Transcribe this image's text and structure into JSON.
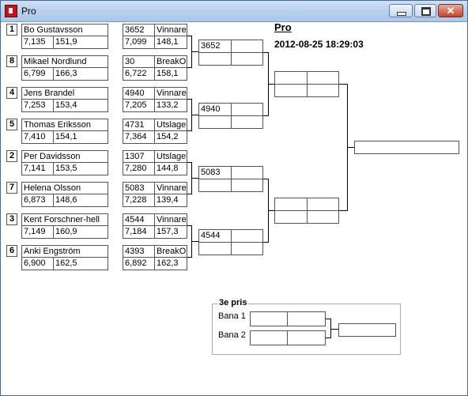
{
  "window": {
    "title": "Pro"
  },
  "heading": "Pro",
  "datetime": "2012-08-25 18:29:03",
  "players": [
    {
      "seed": "1",
      "name": "Bo Gustavsson",
      "avg": "7,135",
      "max": "151,9",
      "score": "3652",
      "status": "Vinnare",
      "avg2": "7,099",
      "max2": "148,1"
    },
    {
      "seed": "8",
      "name": "Mikael Nordlund",
      "avg": "6,799",
      "max": "166,3",
      "score": "30",
      "status": "BreakOut",
      "avg2": "6,722",
      "max2": "158,1"
    },
    {
      "seed": "4",
      "name": "Jens Brandel",
      "avg": "7,253",
      "max": "153,4",
      "score": "4940",
      "status": "Vinnare",
      "avg2": "7,205",
      "max2": "133,2"
    },
    {
      "seed": "5",
      "name": "Thomas Eriksson",
      "avg": "7,410",
      "max": "154,1",
      "score": "4731",
      "status": "Utslagen",
      "avg2": "7,364",
      "max2": "154,2"
    },
    {
      "seed": "2",
      "name": "Per Davidsson",
      "avg": "7,141",
      "max": "153,5",
      "score": "1307",
      "status": "Utslagen",
      "avg2": "7,280",
      "max2": "144,8"
    },
    {
      "seed": "7",
      "name": "Helena Olsson",
      "avg": "6,873",
      "max": "148,6",
      "score": "5083",
      "status": "Vinnare",
      "avg2": "7,228",
      "max2": "139,4"
    },
    {
      "seed": "3",
      "name": "Kent Forschner-hell",
      "avg": "7,149",
      "max": "160,9",
      "score": "4544",
      "status": "Vinnare",
      "avg2": "7,184",
      "max2": "157,3"
    },
    {
      "seed": "6",
      "name": "Anki Engström",
      "avg": "6,900",
      "max": "162,5",
      "score": "4393",
      "status": "BreakOut",
      "avg2": "6,892",
      "max2": "162,3"
    }
  ],
  "round2": [
    {
      "score": "3652"
    },
    {
      "score": "4940"
    },
    {
      "score": "5083"
    },
    {
      "score": "4544"
    }
  ],
  "third_place": {
    "title": "3e pris",
    "lane1_label": "Bana 1",
    "lane2_label": "Bana 2"
  }
}
